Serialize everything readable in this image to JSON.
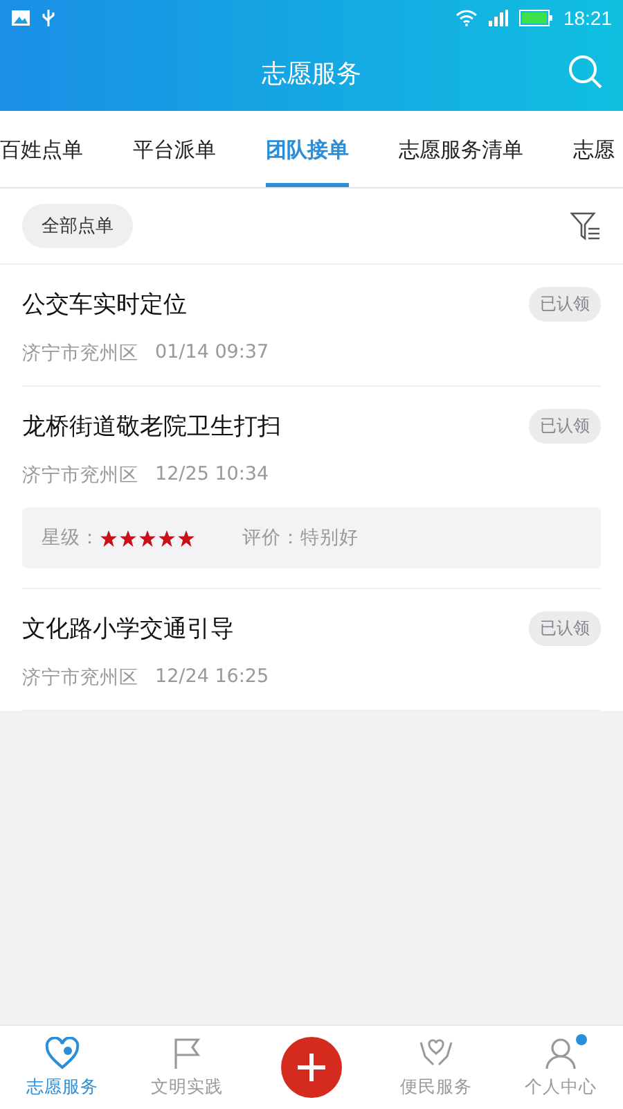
{
  "status_bar": {
    "time": "18:21"
  },
  "header": {
    "title": "志愿服务"
  },
  "tabs": [
    {
      "label": "百姓点单",
      "selected": false
    },
    {
      "label": "平台派单",
      "selected": false
    },
    {
      "label": "团队接单",
      "selected": true
    },
    {
      "label": "志愿服务清单",
      "selected": false
    },
    {
      "label": "志愿",
      "selected": false
    }
  ],
  "filter": {
    "chip": "全部点单"
  },
  "orders": [
    {
      "title": "公交车实时定位",
      "status": "已认领",
      "location": "济宁市兖州区",
      "time": "01/14 09:37"
    },
    {
      "title": "龙桥街道敬老院卫生打扫",
      "status": "已认领",
      "location": "济宁市兖州区",
      "time": "12/25 10:34",
      "rating": {
        "label": "星级：",
        "stars": 5,
        "review": "评价：特别好"
      }
    },
    {
      "title": "文化路小学交通引导",
      "status": "已认领",
      "location": "济宁市兖州区",
      "time": "12/24 16:25"
    }
  ],
  "bottom_nav": [
    {
      "kind": "heart",
      "label": "志愿服务",
      "selected": true,
      "badge": false
    },
    {
      "kind": "flag",
      "label": "文明实践",
      "selected": false,
      "badge": false
    },
    {
      "kind": "add"
    },
    {
      "kind": "hands",
      "label": "便民服务",
      "selected": false,
      "badge": false
    },
    {
      "kind": "person",
      "label": "个人中心",
      "selected": false,
      "badge": true
    }
  ]
}
